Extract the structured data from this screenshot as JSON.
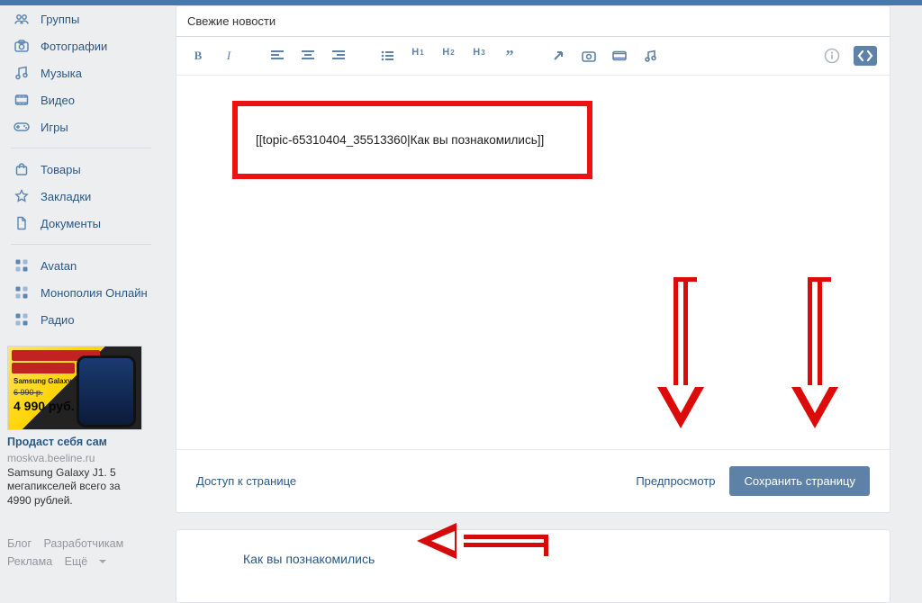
{
  "sidebar": {
    "items": [
      {
        "icon": "people-icon",
        "label": "Группы"
      },
      {
        "icon": "camera-icon",
        "label": "Фотографии"
      },
      {
        "icon": "music-icon",
        "label": "Музыка"
      },
      {
        "icon": "video-icon",
        "label": "Видео"
      },
      {
        "icon": "gamepad-icon",
        "label": "Игры"
      }
    ],
    "items2": [
      {
        "icon": "bag-icon",
        "label": "Товары"
      },
      {
        "icon": "star-icon",
        "label": "Закладки"
      },
      {
        "icon": "document-icon",
        "label": "Документы"
      }
    ],
    "items3": [
      {
        "icon": "app-icon",
        "label": "Avatan"
      },
      {
        "icon": "app-icon",
        "label": "Монополия Онлайн"
      },
      {
        "icon": "app-icon",
        "label": "Радио"
      }
    ]
  },
  "ad": {
    "img_line1": "Samsung Galaxy J1 : 4G",
    "img_old_price": "6 990 р.",
    "img_price": "4 990 руб.",
    "title": "Продаст себя сам",
    "domain": "moskva.beeline.ru",
    "desc": "Samsung Galaxy J1. 5 мегапикселей всего за 4990 рублей."
  },
  "footer_links": {
    "blog": "Блог",
    "devs": "Разработчикам",
    "ads_link": "Реклама",
    "more": "Ещё"
  },
  "editor": {
    "title_value": "Свежие новости",
    "content": "[[topic-65310404_35513360|Как вы познакомились]]"
  },
  "card_footer": {
    "access": "Доступ к странице",
    "preview": "Предпросмотр",
    "save": "Сохранить страницу"
  },
  "result": {
    "link_text": "Как вы познакомились"
  }
}
